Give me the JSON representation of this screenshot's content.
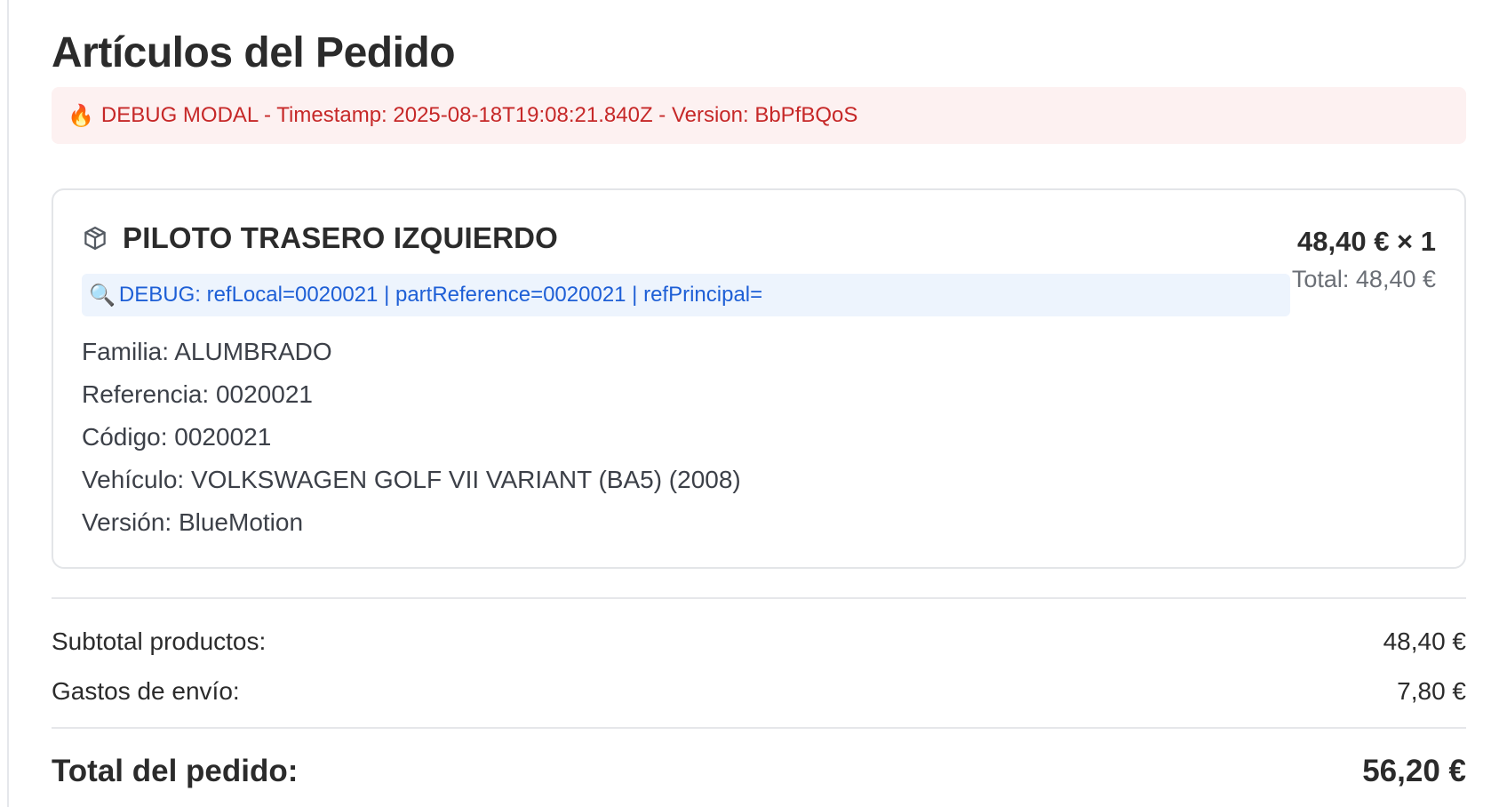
{
  "page": {
    "title": "Artículos del Pedido"
  },
  "debug_modal": {
    "icon": "fire-icon",
    "text": "DEBUG MODAL - Timestamp: 2025-08-18T19:08:21.840Z - Version: BbPfBQoS"
  },
  "item": {
    "icon": "package-icon",
    "name": "PILOTO TRASERO IZQUIERDO",
    "unit_price_qty": "48,40 € × 1",
    "line_total": "Total: 48,40 €",
    "debug": {
      "icon": "magnifier-icon",
      "text": "DEBUG: refLocal=0020021 | partReference=0020021 | refPrincipal="
    },
    "attributes": [
      "Familia: ALUMBRADO",
      "Referencia: 0020021",
      "Código: 0020021",
      "Vehículo: VOLKSWAGEN GOLF VII VARIANT (BA5) (2008)",
      "Versión: BlueMotion"
    ]
  },
  "summary": {
    "subtotal_label": "Subtotal productos:",
    "subtotal_value": "48,40 €",
    "shipping_label": "Gastos de envío:",
    "shipping_value": "7,80 €",
    "total_label": "Total del pedido:",
    "total_value": "56,20 €"
  },
  "colors": {
    "debug_modal_bg": "#fdf1f1",
    "debug_modal_text": "#c62828",
    "debug_ref_bg": "#edf4fd",
    "debug_ref_text": "#1e5fd6"
  }
}
